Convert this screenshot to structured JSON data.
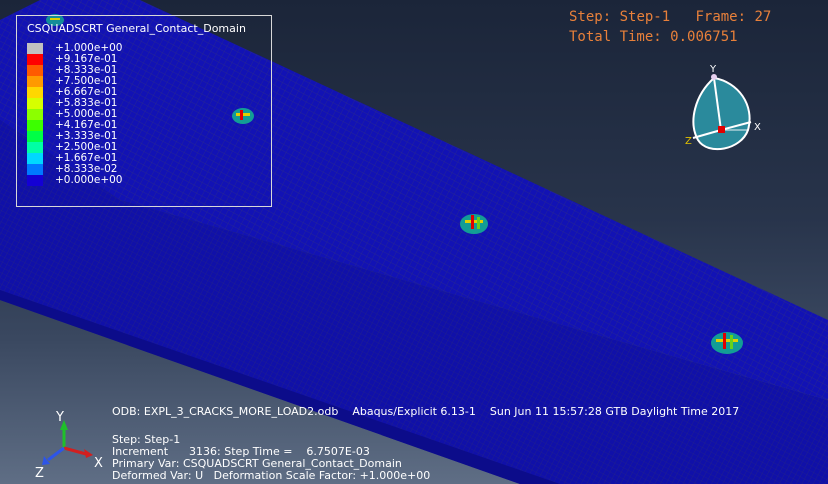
{
  "viewport": {
    "background_top": "#1b2539",
    "background_bottom": "#5f6e85",
    "mesh_color": "#1111b8",
    "crack_colors": [
      "#13e0a6",
      "#66d21c",
      "#e6e000",
      "#e00000"
    ]
  },
  "legend": {
    "title": "CSQUADSCRT General_Contact_Domain",
    "entries": [
      {
        "label": "+1.000e+00",
        "color": "#c0c0c0"
      },
      {
        "label": "+9.167e-01",
        "color": "#ff0000"
      },
      {
        "label": "+8.333e-01",
        "color": "#ff5a00"
      },
      {
        "label": "+7.500e-01",
        "color": "#ff9a00"
      },
      {
        "label": "+6.667e-01",
        "color": "#ffd700"
      },
      {
        "label": "+5.833e-01",
        "color": "#d6ff00"
      },
      {
        "label": "+5.000e-01",
        "color": "#8cff00"
      },
      {
        "label": "+4.167e-01",
        "color": "#3cff00"
      },
      {
        "label": "+3.333e-01",
        "color": "#00ff46"
      },
      {
        "label": "+2.500e-01",
        "color": "#00ffa5"
      },
      {
        "label": "+1.667e-01",
        "color": "#00d8ff"
      },
      {
        "label": "+8.333e-02",
        "color": "#0078ff"
      },
      {
        "label": "+0.000e+00",
        "color": "#1400d4"
      }
    ]
  },
  "step_info": {
    "step_label": "Step:",
    "step_value": "Step-1",
    "frame_label": "Frame:",
    "frame_value": "27",
    "total_time_label": "Total Time:",
    "total_time_value": "0.006751"
  },
  "view_cube": {
    "y_label": "Y",
    "z_label": "Z",
    "x_label": "X"
  },
  "triad": {
    "y_label": "Y",
    "z_label": "Z",
    "x_label": "X",
    "y_color": "#1fbf2a",
    "z_color": "#2d55e8",
    "x_color": "#d21f1f"
  },
  "info": {
    "odb_line": "ODB: EXPL_3_CRACKS_MORE_LOAD2.odb    Abaqus/Explicit 6.13-1    Sun Jun 11 15:57:28 GTB Daylight Time 2017",
    "step_line": "Step: Step-1",
    "increment_line": "Increment      3136: Step Time =    6.7507E-03",
    "primary_var_line": "Primary Var: CSQUADSCRT General_Contact_Domain",
    "deformed_var_line": "Deformed Var: U   Deformation Scale Factor: +1.000e+00"
  }
}
